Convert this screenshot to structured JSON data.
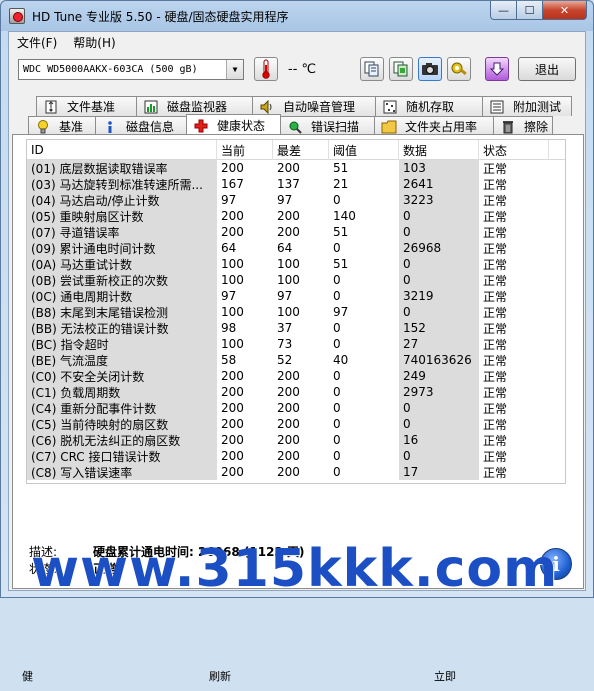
{
  "window": {
    "title": "HD Tune 专业版 5.50 - 硬盘/固态硬盘实用程序",
    "min_glyph": "—",
    "max_glyph": "☐",
    "close_glyph": "✕"
  },
  "menu": [
    "文件(F)",
    "帮助(H)"
  ],
  "toolbar": {
    "drive": "WDC WD5000AAKX-603CA (500 gB)",
    "temperature": "-- ℃",
    "exit_label": "退出",
    "icons": [
      "thermometer-icon",
      "copy-text-icon",
      "copy-screenshot-icon",
      "camera-icon",
      "options-icon",
      "download-icon"
    ]
  },
  "tabs_top": [
    {
      "label": "文件基准",
      "icon": "file-benchmark-icon",
      "glyph": "💡"
    },
    {
      "label": "磁盘监视器",
      "icon": "disk-monitor-icon",
      "glyph": "▥"
    },
    {
      "label": "自动噪音管理",
      "icon": "speaker-icon",
      "glyph": "🔊"
    },
    {
      "label": "随机存取",
      "icon": "random-access-icon",
      "glyph": "▦"
    },
    {
      "label": "附加测试",
      "icon": "extra-tests-icon",
      "glyph": "▤"
    }
  ],
  "tabs_bottom": [
    {
      "label": "基准",
      "icon": "bulb-icon",
      "glyph": "💡"
    },
    {
      "label": "磁盘信息",
      "icon": "info-icon",
      "glyph": "ℹ"
    },
    {
      "label": "健康状态",
      "icon": "health-cross-icon",
      "glyph": "✚",
      "active": true
    },
    {
      "label": "错误扫描",
      "icon": "scan-icon",
      "glyph": "🔍"
    },
    {
      "label": "文件夹占用率",
      "icon": "folder-icon",
      "glyph": "📁"
    },
    {
      "label": "擦除",
      "icon": "trash-icon",
      "glyph": "🗑"
    }
  ],
  "table": {
    "headers": [
      "ID",
      "当前",
      "最差",
      "阈值",
      "数据",
      "状态"
    ],
    "rows": [
      [
        "(01) 底层数据读取错误率",
        "200",
        "200",
        "51",
        "103",
        "正常"
      ],
      [
        "(03) 马达旋转到标准转速所需...",
        "167",
        "137",
        "21",
        "2641",
        "正常"
      ],
      [
        "(04) 马达启动/停止计数",
        "97",
        "97",
        "0",
        "3223",
        "正常"
      ],
      [
        "(05) 重映射扇区计数",
        "200",
        "200",
        "140",
        "0",
        "正常"
      ],
      [
        "(07) 寻道错误率",
        "200",
        "200",
        "51",
        "0",
        "正常"
      ],
      [
        "(09) 累计通电时间计数",
        "64",
        "64",
        "0",
        "26968",
        "正常"
      ],
      [
        "(0A) 马达重试计数",
        "100",
        "100",
        "51",
        "0",
        "正常"
      ],
      [
        "(0B) 尝试重新校正的次数",
        "100",
        "100",
        "0",
        "0",
        "正常"
      ],
      [
        "(0C) 通电周期计数",
        "97",
        "97",
        "0",
        "3219",
        "正常"
      ],
      [
        "(B8) 末尾到末尾错误检测",
        "100",
        "100",
        "97",
        "0",
        "正常"
      ],
      [
        "(BB) 无法校正的错误计数",
        "98",
        "37",
        "0",
        "152",
        "正常"
      ],
      [
        "(BC) 指令超时",
        "100",
        "73",
        "0",
        "27",
        "正常"
      ],
      [
        "(BE) 气流温度",
        "58",
        "52",
        "40",
        "740163626",
        "正常"
      ],
      [
        "(C0) 不安全关闭计数",
        "200",
        "200",
        "0",
        "249",
        "正常"
      ],
      [
        "(C1) 负载周期数",
        "200",
        "200",
        "0",
        "2973",
        "正常"
      ],
      [
        "(C4) 重新分配事件计数",
        "200",
        "200",
        "0",
        "0",
        "正常"
      ],
      [
        "(C5) 当前待映射的扇区数",
        "200",
        "200",
        "0",
        "0",
        "正常"
      ],
      [
        "(C6) 脱机无法纠正的扇区数",
        "200",
        "200",
        "0",
        "16",
        "正常"
      ],
      [
        "(C7) CRC 接口错误计数",
        "200",
        "200",
        "0",
        "0",
        "正常"
      ],
      [
        "(C8) 写入错误速率",
        "200",
        "200",
        "0",
        "17",
        "正常"
      ]
    ]
  },
  "details": {
    "desc_label": "描述:",
    "desc_value": "硬盘累计通电时间: 26968 (1123 天)",
    "status_label": "状态:",
    "status_value": "正常"
  },
  "statusbar": {
    "left": "健",
    "mid": "刷新",
    "right": "立即"
  },
  "watermark": "www.315kkk.com",
  "colors": {
    "titlebar": "#bcd4ee",
    "watermark": "#1c4fc4",
    "close": "#c8462e"
  }
}
